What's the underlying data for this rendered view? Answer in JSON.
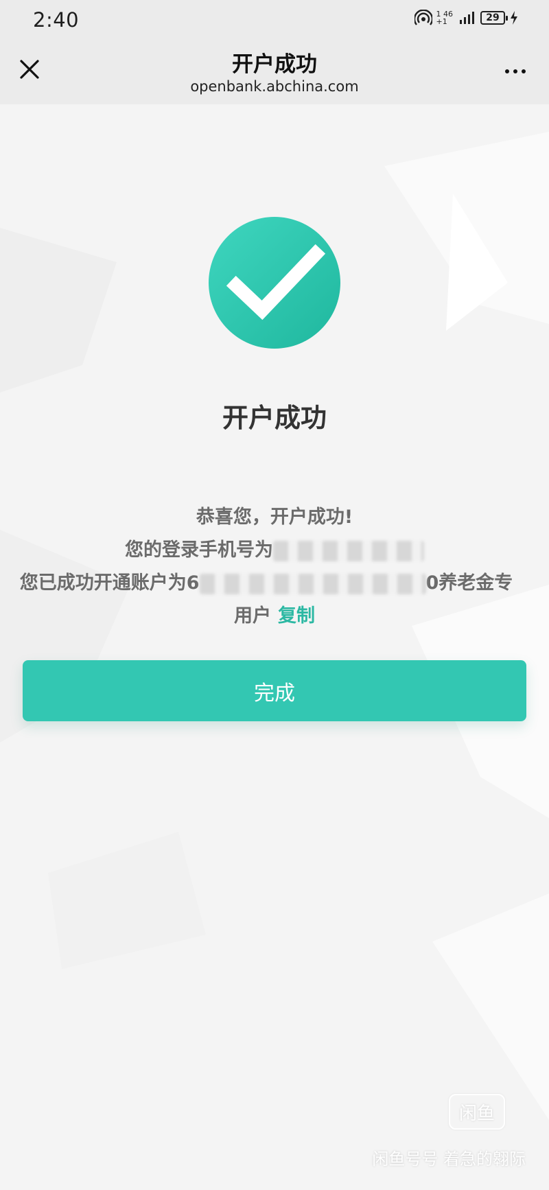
{
  "status_bar": {
    "time": "2:40",
    "network_top": "1 46",
    "network_bottom": "+1",
    "battery": "29"
  },
  "header": {
    "title": "开户成功",
    "subtitle": "openbank.abchina.com"
  },
  "main": {
    "success_title": "开户成功",
    "message_line1": "恭喜您，开户成功!",
    "message_line2_prefix": "您的登录手机号为",
    "message_line3_prefix": "您已成功开通账户为6",
    "message_line3_suffix": "0养老金专",
    "message_line4": "用户",
    "copy_label": "复制",
    "done_label": "完成"
  },
  "watermark": {
    "logo_text": "闲鱼",
    "text": "闲鱼号号 着急的翱际"
  },
  "colors": {
    "accent": "#33c7b2",
    "link": "#2cb8a3",
    "background": "#f4f4f4"
  },
  "icons": {
    "close": "close-icon",
    "more": "more-icon",
    "success": "checkmark-icon"
  }
}
